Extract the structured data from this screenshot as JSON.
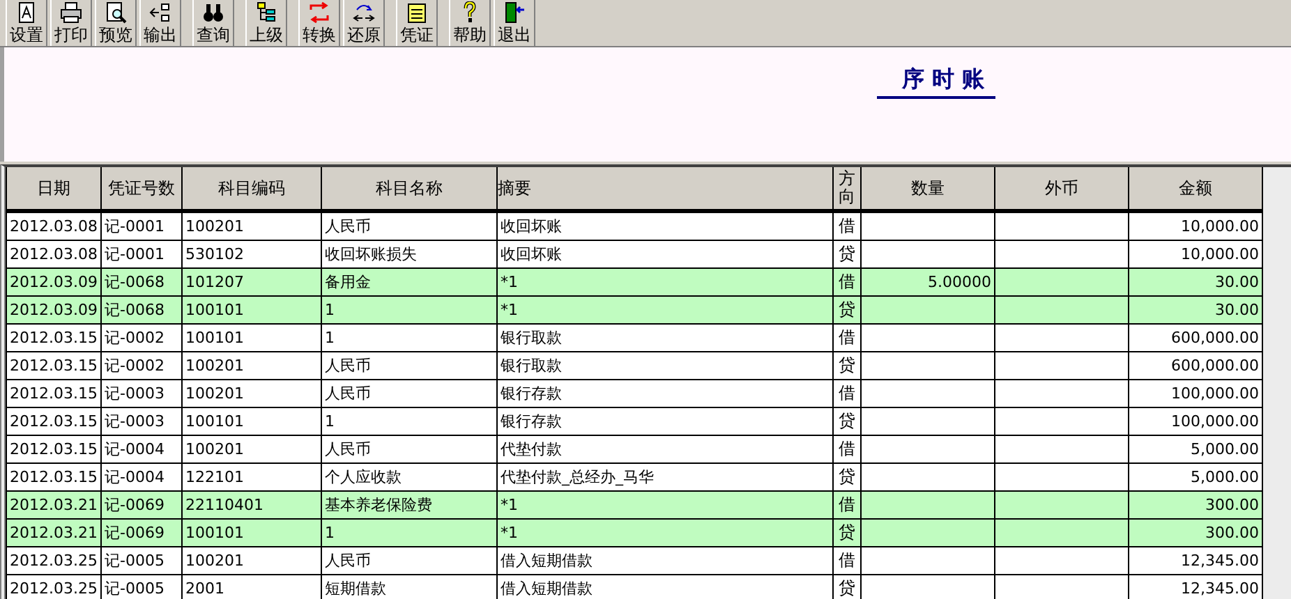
{
  "toolbar": [
    {
      "label": "设置"
    },
    {
      "label": "打印"
    },
    {
      "label": "预览"
    },
    {
      "label": "输出"
    },
    {
      "label": "查询"
    },
    {
      "label": "上级"
    },
    {
      "label": "转换"
    },
    {
      "label": "还原"
    },
    {
      "label": "凭证"
    },
    {
      "label": "帮助"
    },
    {
      "label": "退出"
    }
  ],
  "report": {
    "title": "序 时 账"
  },
  "table": {
    "columns": [
      "日期",
      "凭证号数",
      "科目编码",
      "科目名称",
      "摘要",
      "方向",
      "数量",
      "外币",
      "金额"
    ],
    "rows": [
      {
        "date": "2012.03.08",
        "voucher": "记-0001",
        "code": "100201",
        "name": "人民币",
        "summary": "收回坏账",
        "direction": "借",
        "amount": "10,000.00",
        "highlighted": false
      },
      {
        "date": "2012.03.08",
        "voucher": "记-0001",
        "code": "530102",
        "name": "收回坏账损失",
        "summary": "收回坏账",
        "direction": "贷",
        "amount": "10,000.00",
        "highlighted": false
      },
      {
        "date": "2012.03.09",
        "voucher": "记-0068",
        "code": "101207",
        "name": "备用金",
        "summary": "*1",
        "direction": "借",
        "quantity": "5.00000",
        "amount": "30.00",
        "highlighted": true
      },
      {
        "date": "2012.03.09",
        "voucher": "记-0068",
        "code": "100101",
        "name": "1",
        "summary": "*1",
        "direction": "贷",
        "amount": "30.00",
        "highlighted": true
      },
      {
        "date": "2012.03.15",
        "voucher": "记-0002",
        "code": "100101",
        "name": "1",
        "summary": "银行取款",
        "direction": "借",
        "amount": "600,000.00",
        "highlighted": false
      },
      {
        "date": "2012.03.15",
        "voucher": "记-0002",
        "code": "100201",
        "name": "人民币",
        "summary": "银行取款",
        "direction": "贷",
        "amount": "600,000.00",
        "highlighted": false
      },
      {
        "date": "2012.03.15",
        "voucher": "记-0003",
        "code": "100201",
        "name": "人民币",
        "summary": "银行存款",
        "direction": "借",
        "amount": "100,000.00",
        "highlighted": false
      },
      {
        "date": "2012.03.15",
        "voucher": "记-0003",
        "code": "100101",
        "name": "1",
        "summary": "银行存款",
        "direction": "贷",
        "amount": "100,000.00",
        "highlighted": false
      },
      {
        "date": "2012.03.15",
        "voucher": "记-0004",
        "code": "100201",
        "name": "人民币",
        "summary": "代垫付款",
        "direction": "借",
        "amount": "5,000.00",
        "highlighted": false
      },
      {
        "date": "2012.03.15",
        "voucher": "记-0004",
        "code": "122101",
        "name": "个人应收款",
        "summary": "代垫付款_总经办_马华",
        "direction": "贷",
        "amount": "5,000.00",
        "highlighted": false
      },
      {
        "date": "2012.03.21",
        "voucher": "记-0069",
        "code": "22110401",
        "name": "基本养老保险费",
        "summary": "*1",
        "direction": "借",
        "amount": "300.00",
        "highlighted": true
      },
      {
        "date": "2012.03.21",
        "voucher": "记-0069",
        "code": "100101",
        "name": "1",
        "summary": "*1",
        "direction": "贷",
        "amount": "300.00",
        "highlighted": true
      },
      {
        "date": "2012.03.25",
        "voucher": "记-0005",
        "code": "100201",
        "name": "人民币",
        "summary": "借入短期借款",
        "direction": "借",
        "amount": "12,345.00",
        "highlighted": false
      },
      {
        "date": "2012.03.25",
        "voucher": "记-0005",
        "code": "2001",
        "name": "短期借款",
        "summary": "借入短期借款",
        "direction": "贷",
        "amount": "12,345.00",
        "highlighted": false
      }
    ]
  }
}
